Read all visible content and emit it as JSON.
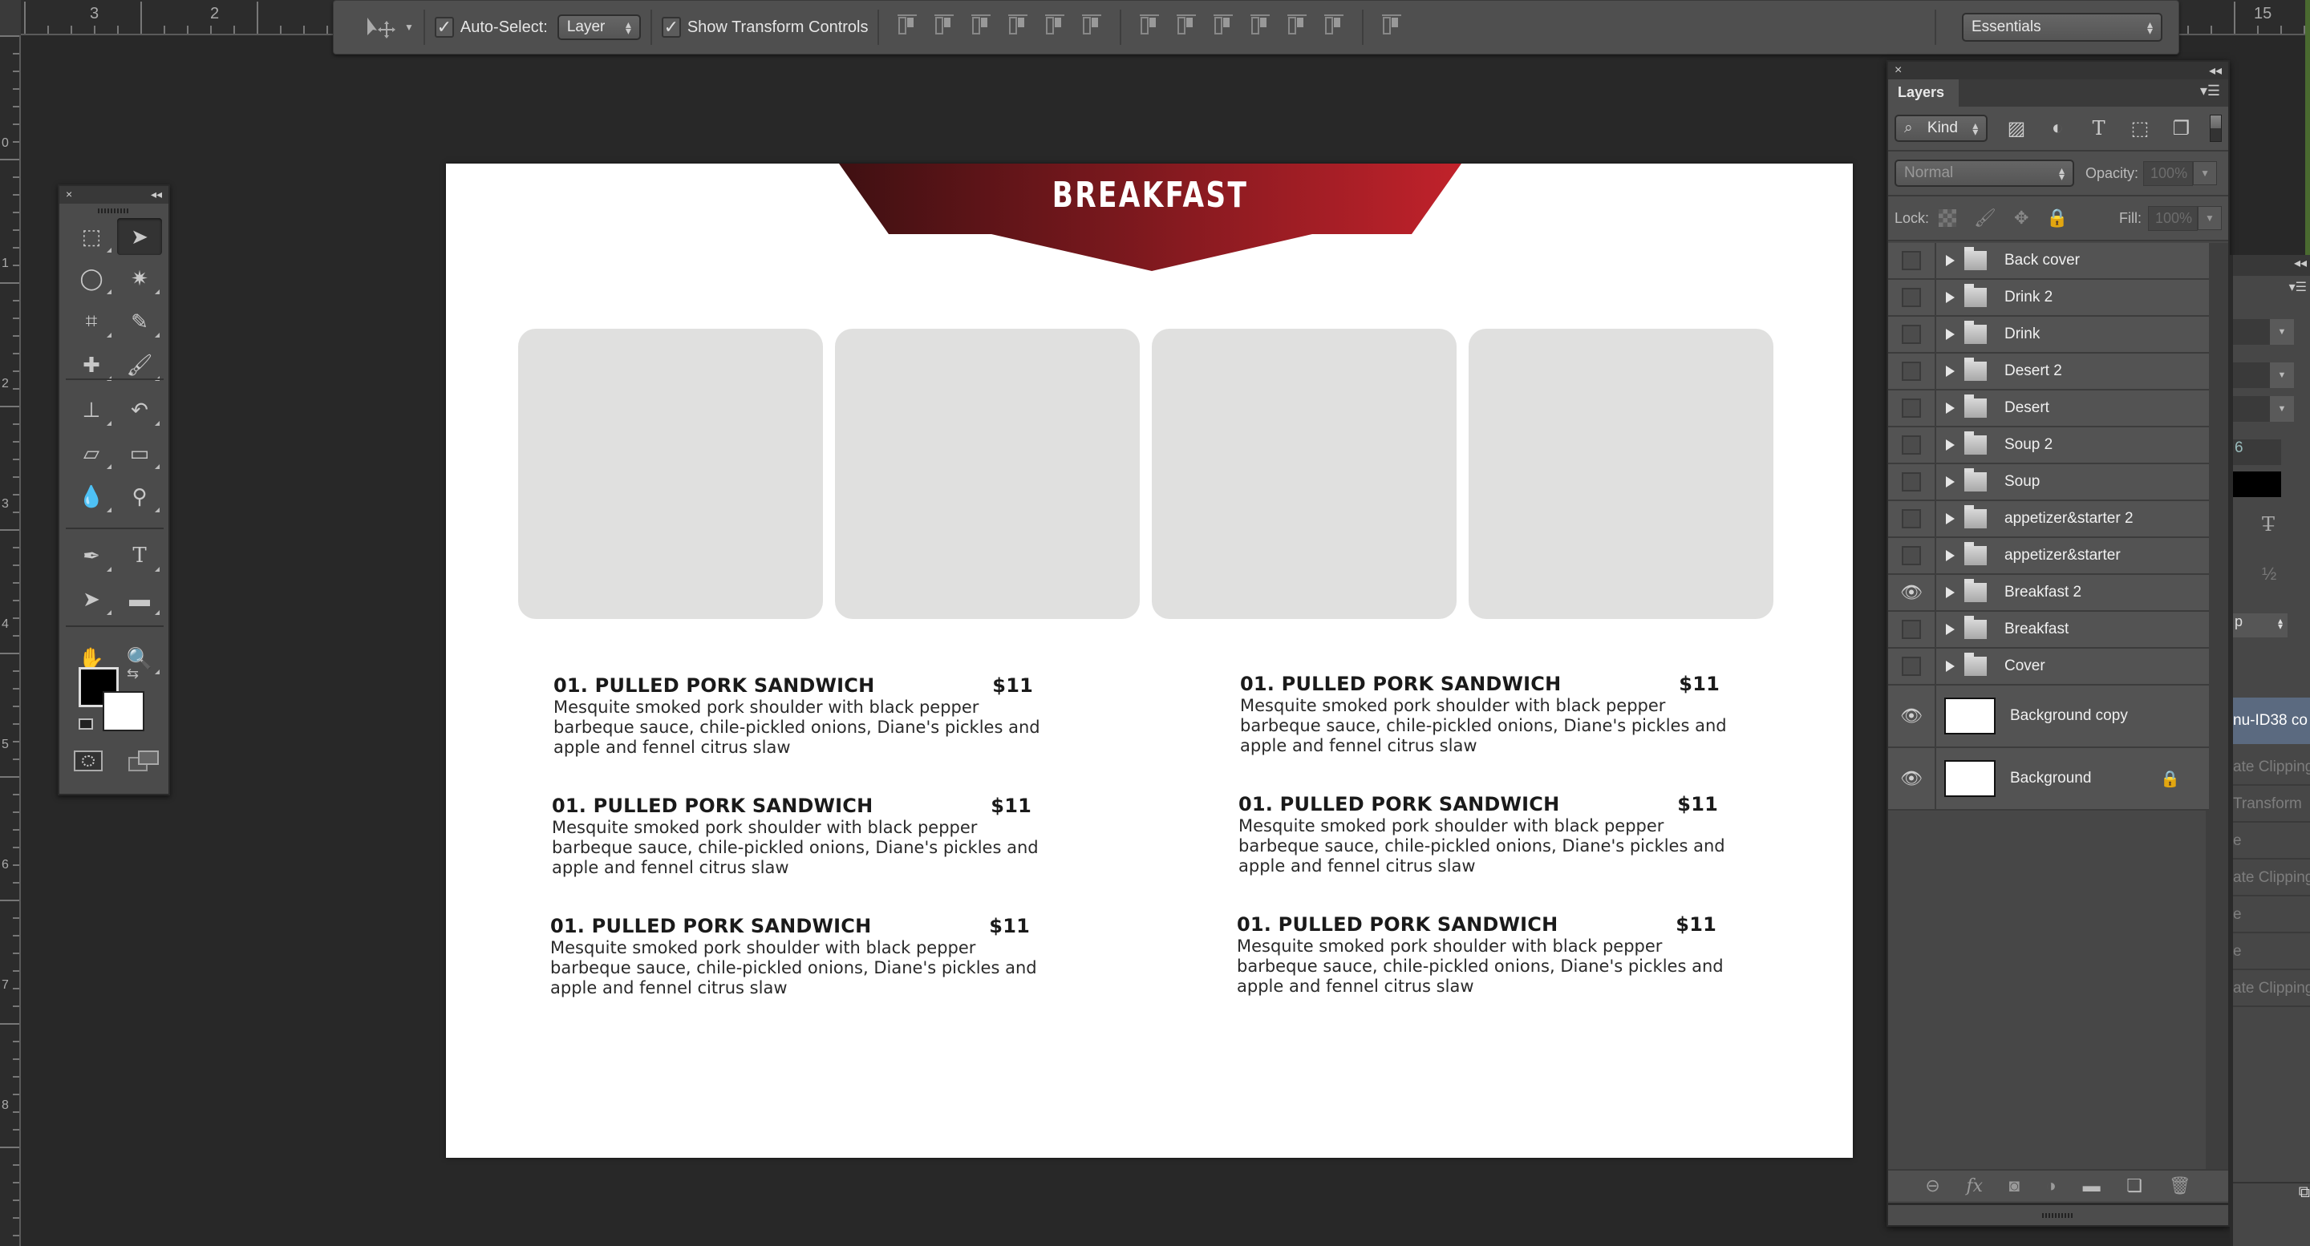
{
  "rulers": {
    "top_numbers": [
      "3",
      "2",
      "15"
    ],
    "left_numbers": [
      "0",
      "1",
      "2",
      "3",
      "4",
      "5",
      "6",
      "7",
      "8"
    ]
  },
  "options_bar": {
    "tool_icon": "move-tool-icon",
    "auto_select_checked": true,
    "auto_select_label": "Auto-Select:",
    "auto_select_value": "Layer",
    "show_transform_checked": true,
    "show_transform_label": "Show Transform Controls",
    "align_icons": [
      "align-top-edges",
      "align-vertical-centers",
      "align-bottom-edges",
      "align-left-edges",
      "align-horizontal-centers",
      "align-right-edges",
      "distribute-top",
      "distribute-vertical-centers",
      "distribute-bottom",
      "distribute-left",
      "distribute-horizontal-centers",
      "distribute-right",
      "auto-align-layers"
    ],
    "workspace": "Essentials"
  },
  "canvas": {
    "banner_title": "BREAKFAST",
    "banner_colors": [
      "#3f1012",
      "#c1222b"
    ],
    "placeholder_color": "#e0e0df",
    "menu_items": [
      {
        "name": "01. PULLED PORK SANDWICH",
        "price": "$11",
        "description": "Mesquite smoked pork shoulder with black pepper barbeque sauce, chile-pickled onions, Diane's pickles and apple and fennel citrus slaw"
      },
      {
        "name": "01. PULLED PORK SANDWICH",
        "price": "$11",
        "description": "Mesquite smoked pork shoulder with black pepper barbeque sauce, chile-pickled onions, Diane's pickles and apple and fennel citrus slaw"
      },
      {
        "name": "01. PULLED PORK SANDWICH",
        "price": "$11",
        "description": "Mesquite smoked pork shoulder with black pepper barbeque sauce, chile-pickled onions, Diane's pickles and apple and fennel citrus slaw"
      },
      {
        "name": "01. PULLED PORK SANDWICH",
        "price": "$11",
        "description": "Mesquite smoked pork shoulder with black pepper barbeque sauce, chile-pickled onions, Diane's pickles and apple and fennel citrus slaw"
      },
      {
        "name": "01. PULLED PORK SANDWICH",
        "price": "$11",
        "description": "Mesquite smoked pork shoulder with black pepper barbeque sauce, chile-pickled onions, Diane's pickles and apple and fennel citrus slaw"
      },
      {
        "name": "01. PULLED PORK SANDWICH",
        "price": "$11",
        "description": "Mesquite smoked pork shoulder with black pepper barbeque sauce, chile-pickled onions, Diane's pickles and apple and fennel citrus slaw"
      }
    ]
  },
  "tools_panel": {
    "close": "×",
    "collapse": "◂◂",
    "tools": [
      "rectangular-marquee",
      "move",
      "lasso",
      "magic-wand",
      "crop",
      "eyedropper",
      "spot-healing-brush",
      "brush",
      "clone-stamp",
      "history-brush",
      "eraser",
      "gradient",
      "blur",
      "dodge",
      "pen",
      "type",
      "path-selection",
      "rectangle",
      "hand",
      "zoom"
    ],
    "foreground_color": "#000000",
    "background_color": "#ffffff"
  },
  "layers_panel": {
    "close": "×",
    "collapse": "◂◂",
    "tab": "Layers",
    "filter_label": "Kind",
    "blend_mode": "Normal",
    "opacity_label": "Opacity:",
    "opacity_value": "100%",
    "lock_label": "Lock:",
    "fill_label": "Fill:",
    "fill_value": "100%",
    "layers": [
      {
        "name": "Back cover",
        "type": "group",
        "visible": false
      },
      {
        "name": "Drink 2",
        "type": "group",
        "visible": false
      },
      {
        "name": "Drink",
        "type": "group",
        "visible": false
      },
      {
        "name": "Desert 2",
        "type": "group",
        "visible": false
      },
      {
        "name": "Desert",
        "type": "group",
        "visible": false
      },
      {
        "name": "Soup 2",
        "type": "group",
        "visible": false
      },
      {
        "name": "Soup",
        "type": "group",
        "visible": false
      },
      {
        "name": "appetizer&starter 2",
        "type": "group",
        "visible": false
      },
      {
        "name": "appetizer&starter",
        "type": "group",
        "visible": false
      },
      {
        "name": "Breakfast 2",
        "type": "group",
        "visible": true
      },
      {
        "name": "Breakfast",
        "type": "group",
        "visible": false
      },
      {
        "name": "Cover",
        "type": "group",
        "visible": false
      },
      {
        "name": "Background copy",
        "type": "pixel",
        "visible": true
      },
      {
        "name": "Background",
        "type": "pixel",
        "visible": true,
        "locked": true
      }
    ],
    "footer_icons": [
      "link-layers",
      "layer-style-fx",
      "add-mask",
      "adjustment-layer",
      "new-group",
      "new-layer",
      "delete-layer"
    ]
  },
  "history_panel": {
    "selected_item": "nu-ID38 co",
    "items": [
      "ate Clipping",
      "Transform",
      "e",
      "ate Clipping",
      "e",
      "e",
      "ate Clipping"
    ],
    "field_value": "6",
    "dropdown_value": "p"
  }
}
